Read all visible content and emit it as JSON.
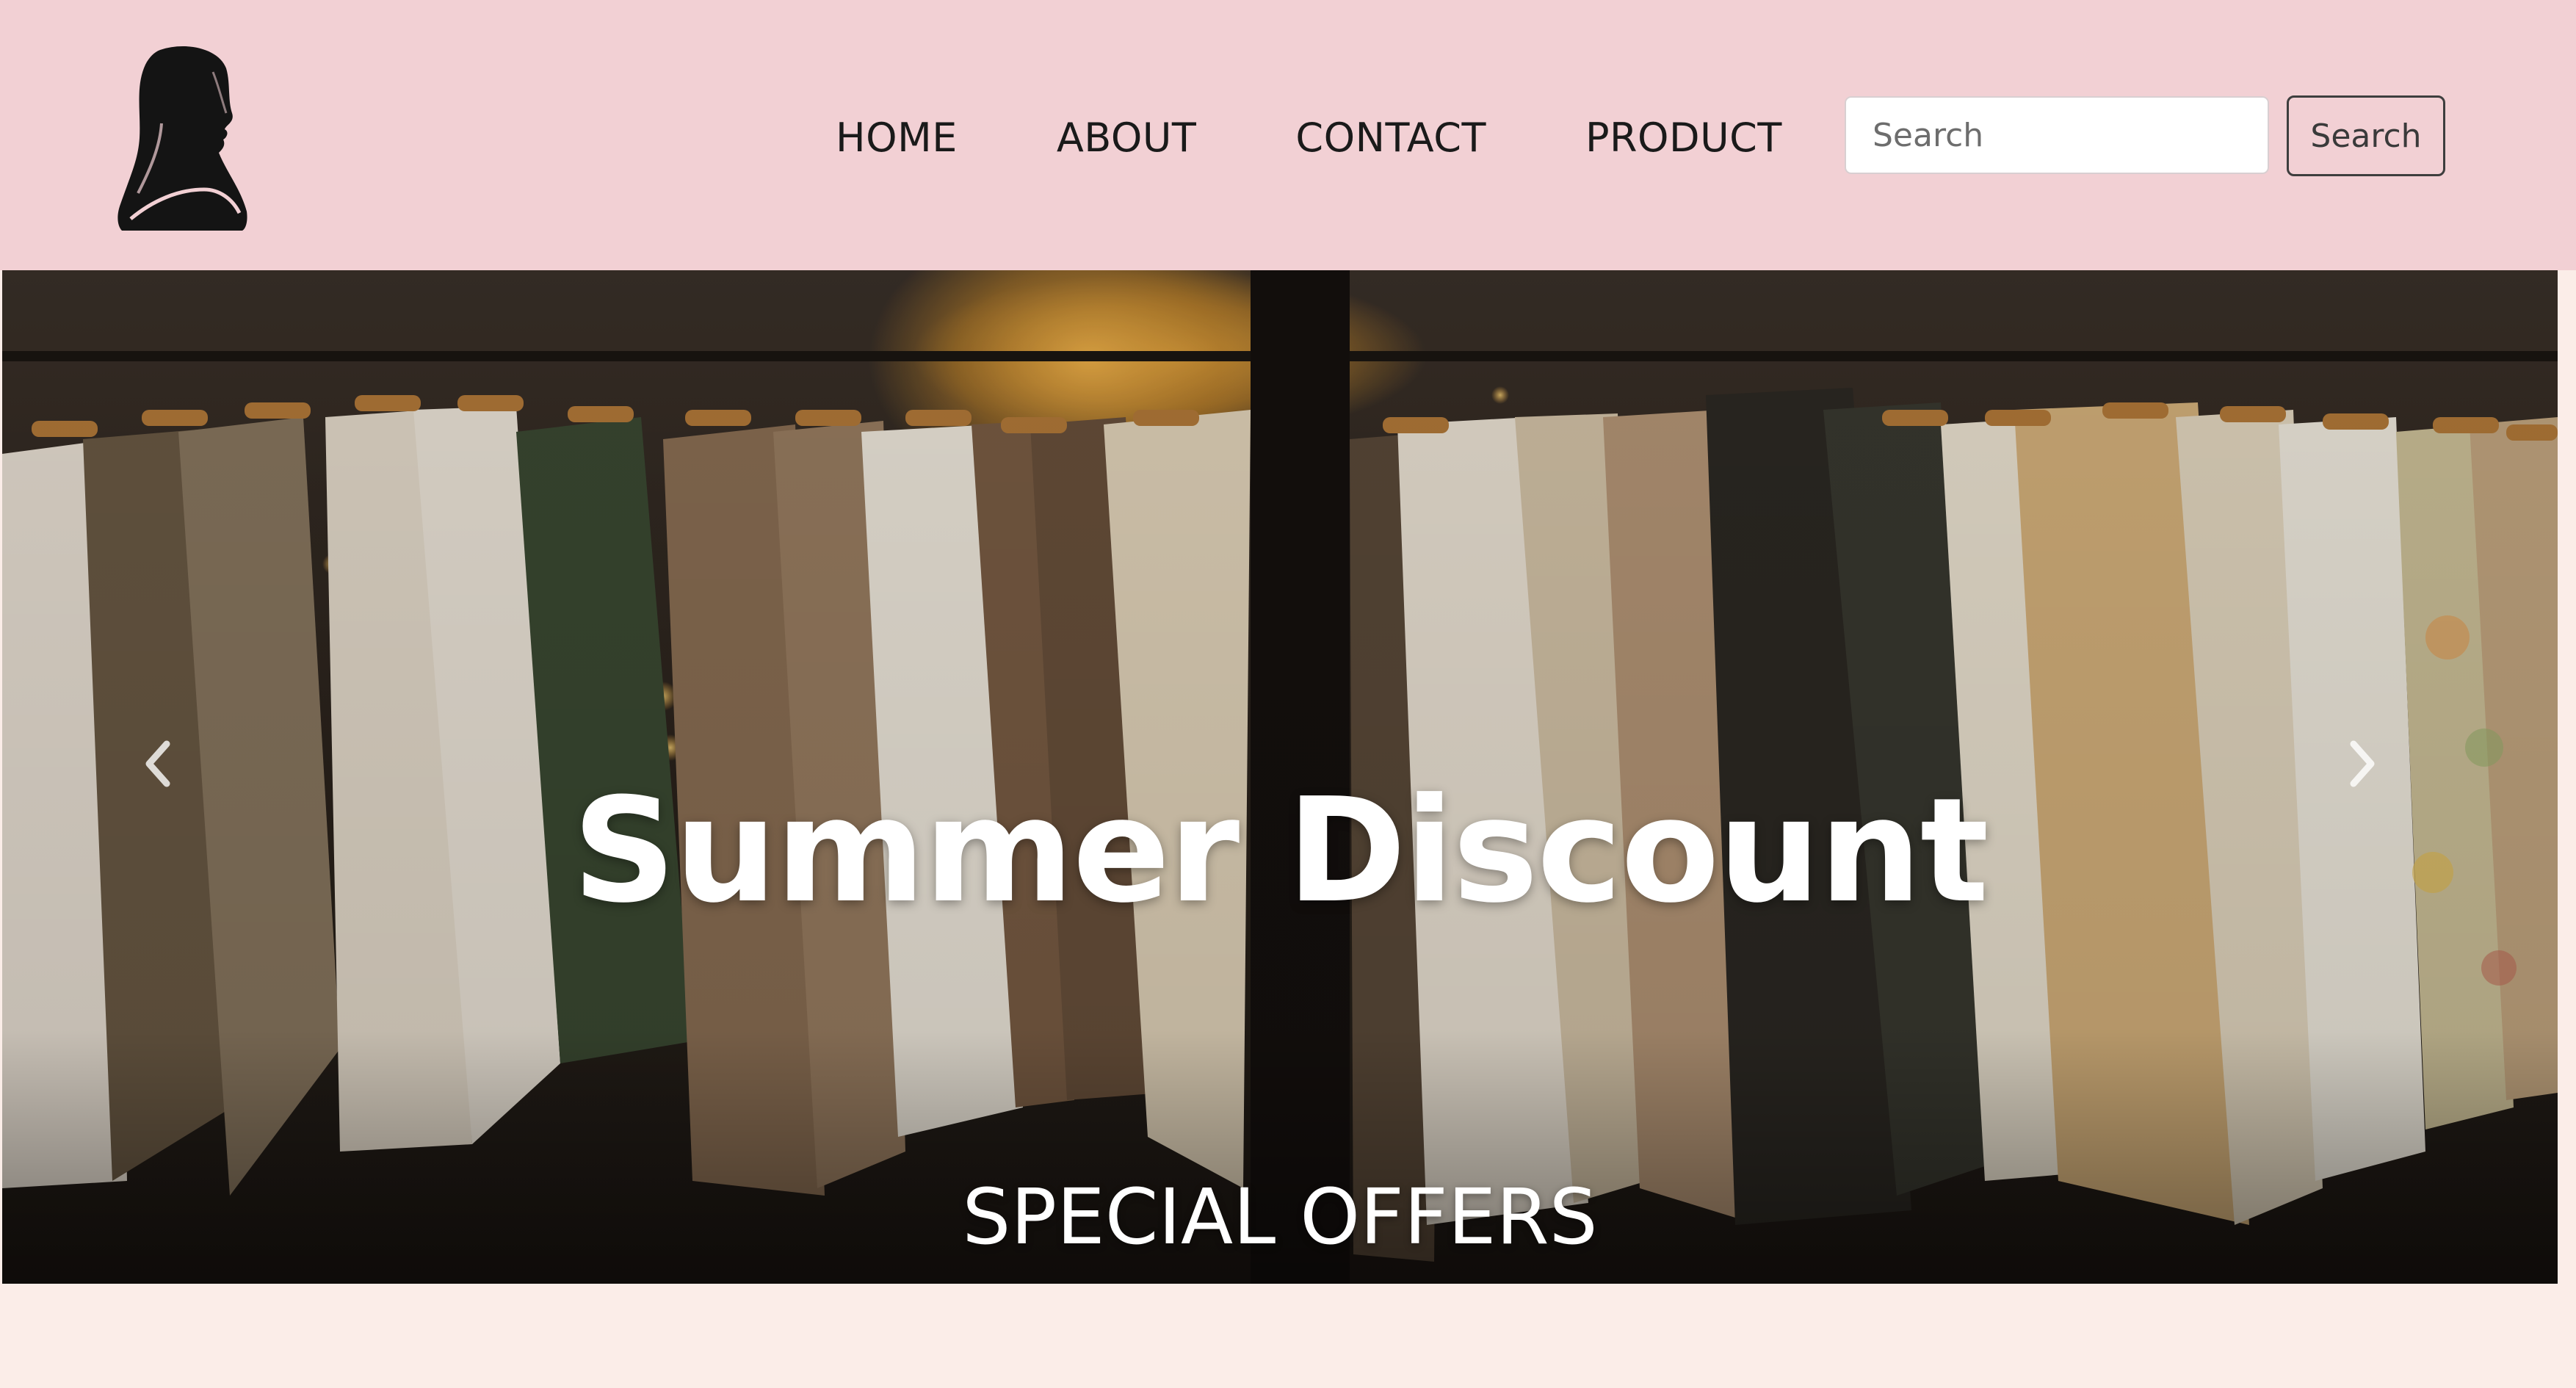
{
  "navbar": {
    "logo_icon": "hijab-woman-silhouette-icon",
    "links": [
      {
        "label": "HOME"
      },
      {
        "label": "ABOUT"
      },
      {
        "label": "CONTACT"
      },
      {
        "label": "PRODUCT"
      }
    ],
    "search": {
      "placeholder": "Search",
      "value": "",
      "button_label": "Search"
    }
  },
  "hero": {
    "title": "Summer Discount",
    "subtitle": "SPECIAL OFFERS",
    "prev_icon": "chevron-left-icon",
    "next_icon": "chevron-right-icon"
  },
  "colors": {
    "navbar_bg": "#f2d0d4",
    "page_bg": "#fbede8",
    "text_dark": "#1a1a1a",
    "hero_text": "#ffffff"
  }
}
